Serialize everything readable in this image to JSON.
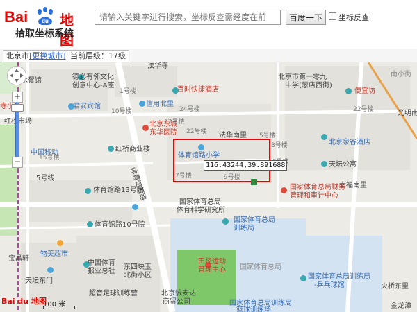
{
  "header": {
    "logo_bai": "Bai",
    "logo_du": "du",
    "logo_tu": "地图",
    "title": "拾取坐标系统",
    "search_placeholder": "请输入关键字进行搜索，坐标反查需经度在前",
    "search_button": "百度一下",
    "reverse_label": "坐标反查"
  },
  "infobar": {
    "city": "北京市",
    "change_city": "[更换城市]",
    "level": "当前层级：17级"
  },
  "coordinate": "116.43244,39.891688",
  "map_labels": {
    "a": "法华寺",
    "b": "德必有邻文化",
    "c": "创意中心-A座",
    "d": "林木餐馆",
    "e": "北京市第一零九",
    "f": "中学(葱店西街)",
    "g": "便宜坊",
    "h": "南小街",
    "i": "寺小区",
    "j": "红桥市场",
    "k": "君安宾馆",
    "l": "信用北里",
    "m": "百时快捷酒店",
    "n": "北京东城",
    "o": "东华医院",
    "p": "法华南里",
    "q": "光明南里",
    "r": "北京泉谷酒店",
    "s": "红桥商业楼",
    "t": "体育馆路小学",
    "u": "中国移动",
    "v": "天坛公寓",
    "w": "体育馆西路",
    "x": "体育馆路13号院",
    "y": "幸福南里",
    "z": "国家体育总局财务",
    "aa": "管理和审计中心",
    "bb": "国家体育总局",
    "cc": "体育科学研究所",
    "dd": "体育馆路10号院",
    "ee": "国家体育总局",
    "ff": "训练局",
    "gg": "物美超市",
    "hh": "中国体育",
    "ii": "报业总社",
    "jj": "东四块玉",
    "kk": "北街小区",
    "ll": "国家体育总局",
    "mm": "田径运动",
    "nn": "管理中心",
    "oo": "宝晶轩",
    "pp": "天坛东门",
    "qq": "超音足球训练营",
    "rr": "北京诚安达",
    "ss": "商贸公司",
    "tt": "国家体育总局训练局",
    "uu": "-乒乓球馆",
    "vv": "国家体育总局训练局",
    "ww": "篮球训练场",
    "xx": "火桥东里",
    "yy": "金龙潭",
    "zz": "5号线",
    "b1": "1号楼",
    "b2": "24号楼",
    "b3": "22号楼",
    "b4": "10号楼",
    "b5": "12号楼",
    "b6": "22号楼",
    "b7": "5号楼",
    "b8": "8号楼",
    "b9": "16号楼",
    "b10": "9号楼",
    "b11": "7号楼",
    "b12": "9号楼",
    "b13": "15号楼"
  },
  "scale_label": "100 米",
  "map_logo": "Bai du 地图",
  "colors": {
    "brand": "#e10602",
    "highlight": "#ee0000",
    "link": "#3366cc"
  }
}
